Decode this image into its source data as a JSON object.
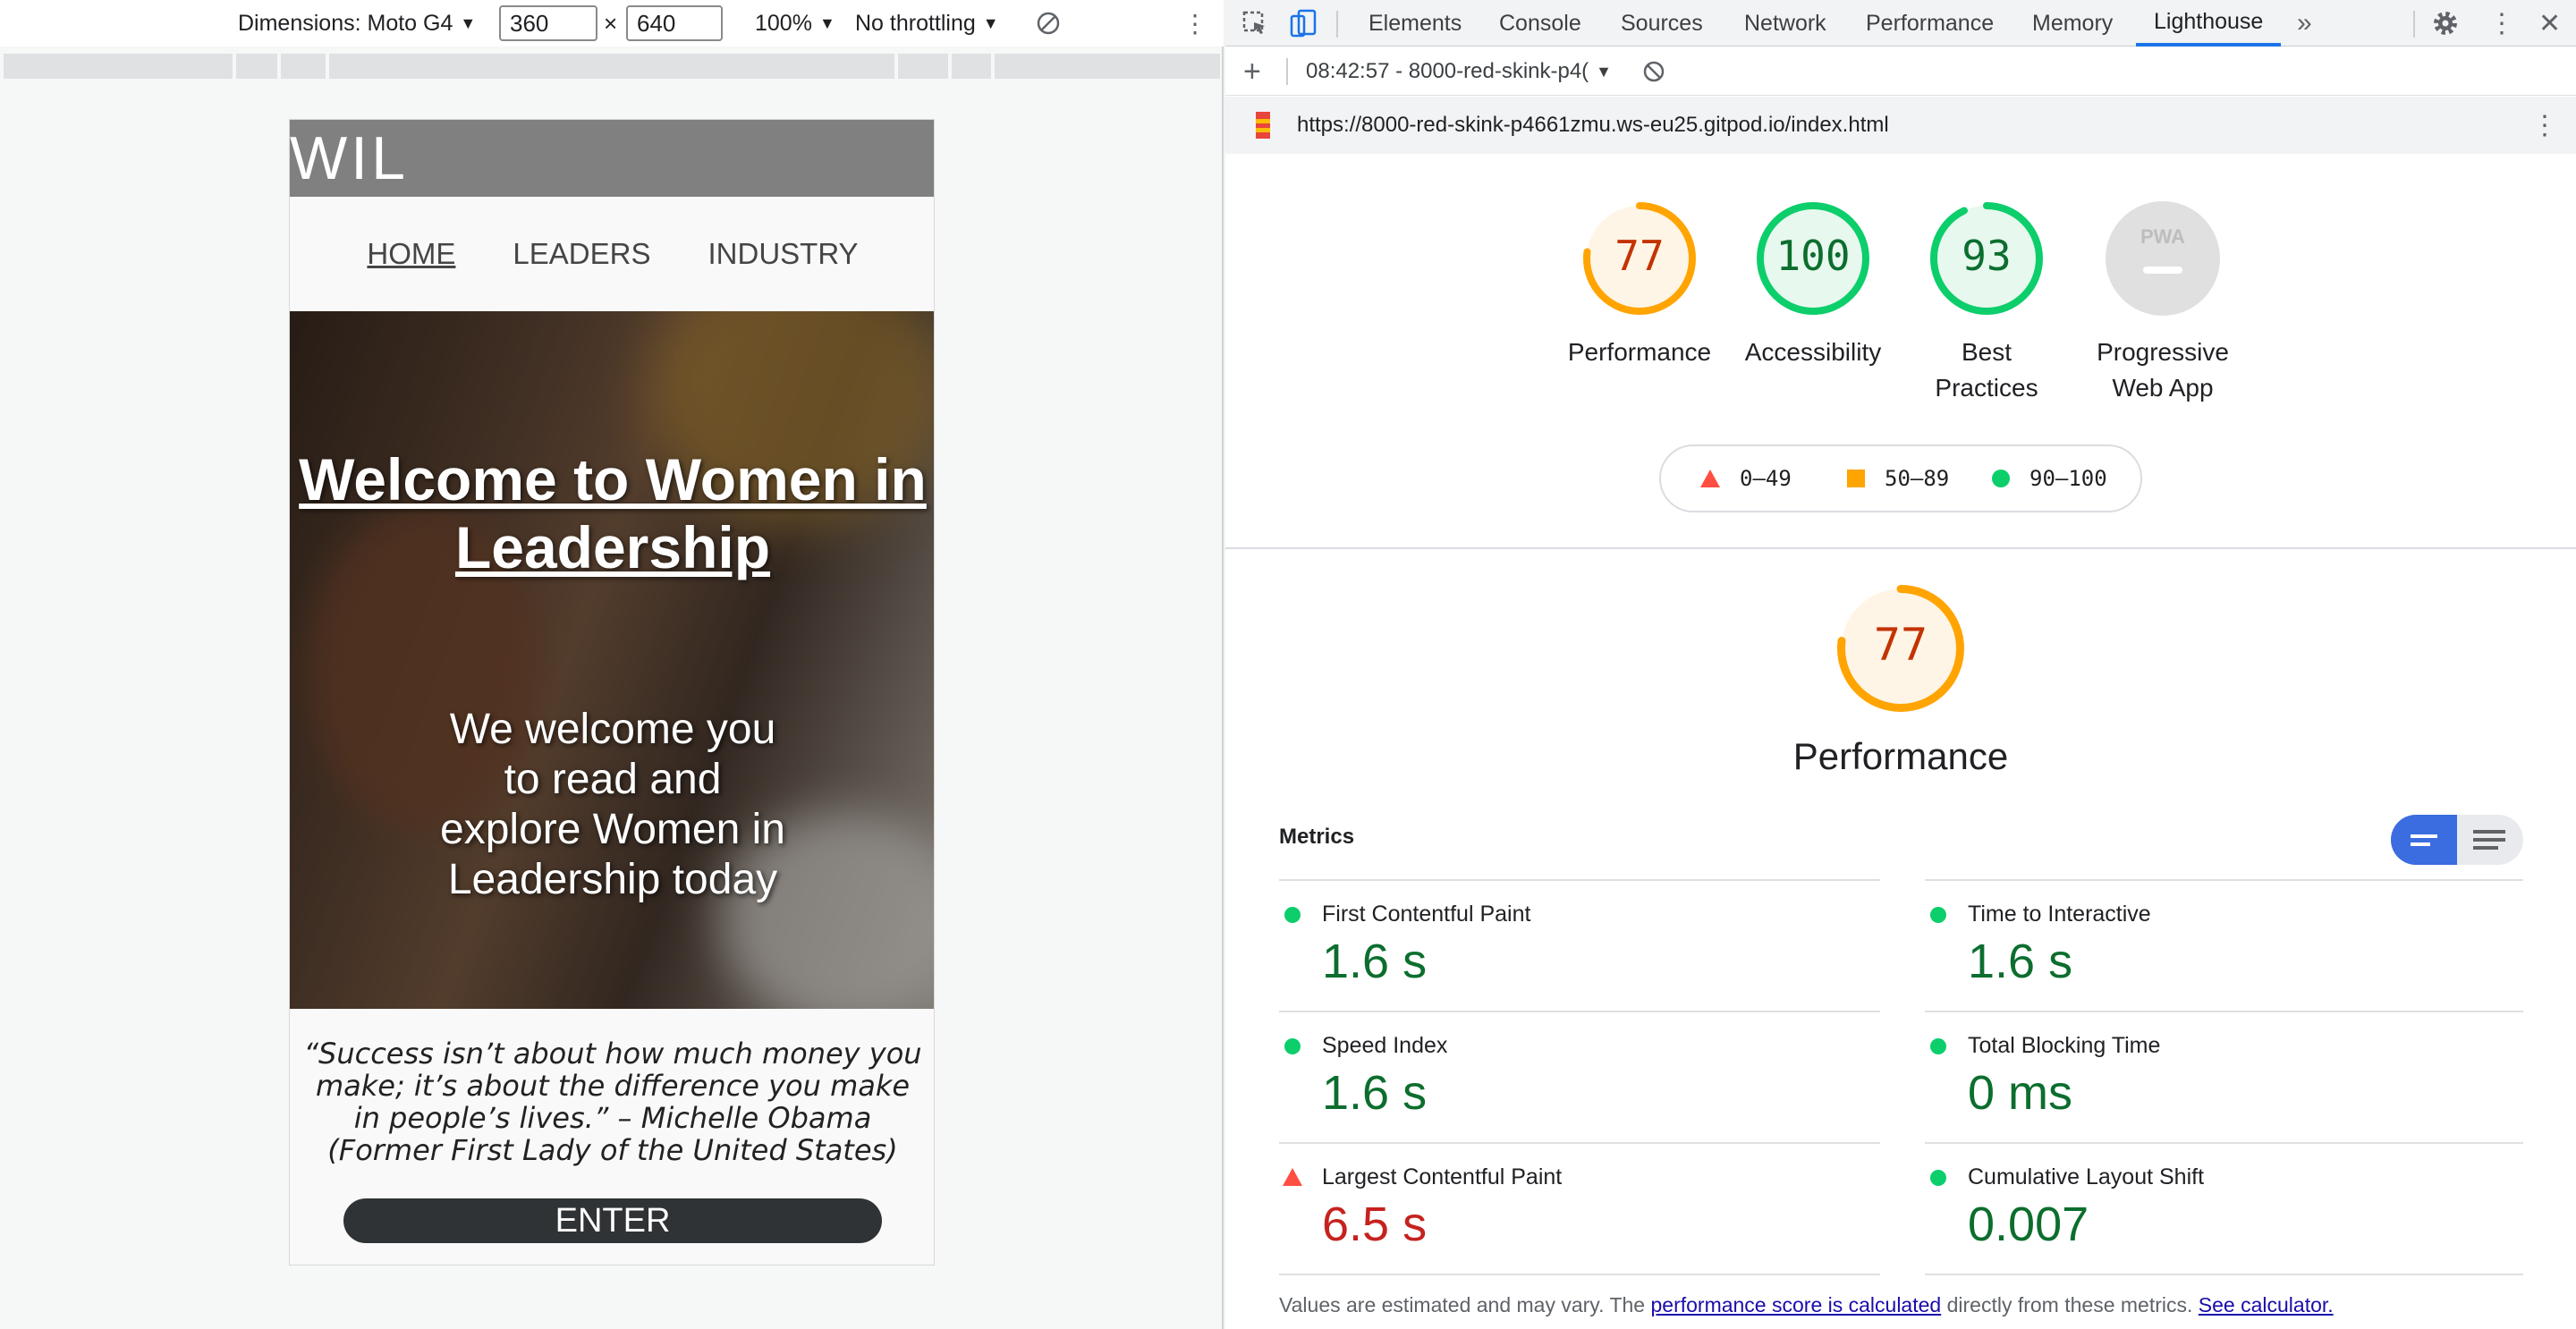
{
  "device_toolbar": {
    "dimensions_label": "Dimensions: Moto G4",
    "width_value": "360",
    "times": "×",
    "height_value": "640",
    "zoom": "100%",
    "throttling": "No throttling"
  },
  "site": {
    "logo": "WIL",
    "nav": [
      "HOME",
      "LEADERS",
      "INDUSTRY"
    ],
    "hero_title": "Welcome to Women in Leadership",
    "hero_subtitle": "We welcome you to read and explore Women in Leadership today",
    "quote": "“Success isn’t about how much money you make; it’s about the difference you make in people’s lives.” – Michelle Obama (Former First Lady of the United States)",
    "enter_label": "ENTER"
  },
  "devtools": {
    "tabs": [
      "Elements",
      "Console",
      "Sources",
      "Network",
      "Performance",
      "Memory",
      "Lighthouse"
    ],
    "active_tab": "Lighthouse",
    "more_tabs": "»",
    "report_selector": "08:42:57 - 8000-red-skink-p4(",
    "url": "https://8000-red-skink-p4661zmu.ws-eu25.gitpod.io/index.html"
  },
  "lighthouse": {
    "scores": [
      {
        "name": "Performance",
        "value": "77",
        "fraction": 0.77,
        "color": "#ffa400",
        "text_color": "#c33300"
      },
      {
        "name": "Accessibility",
        "value": "100",
        "fraction": 1.0,
        "color": "#0cce6b",
        "text_color": "#0c6e2e"
      },
      {
        "name": "Best Practices",
        "value": "93",
        "fraction": 0.93,
        "color": "#0cce6b",
        "text_color": "#0c6e2e"
      },
      {
        "name": "Progressive Web App",
        "value": "PWA",
        "fraction": 0,
        "color": "#9e9e9e",
        "text_color": "#9e9e9e"
      }
    ],
    "legend": [
      "0–49",
      "50–89",
      "90–100"
    ],
    "legend_colors": {
      "fail": "#ff4e42",
      "average": "#ffa400",
      "pass": "#0cce6b"
    },
    "section_title": "Performance",
    "section_score": "77",
    "metrics_title": "Metrics",
    "metrics": [
      {
        "name": "First Contentful Paint",
        "value": "1.6 s",
        "status": "pass"
      },
      {
        "name": "Time to Interactive",
        "value": "1.6 s",
        "status": "pass"
      },
      {
        "name": "Speed Index",
        "value": "1.6 s",
        "status": "pass"
      },
      {
        "name": "Total Blocking Time",
        "value": "0 ms",
        "status": "pass"
      },
      {
        "name": "Largest Contentful Paint",
        "value": "6.5 s",
        "status": "fail"
      },
      {
        "name": "Cumulative Layout Shift",
        "value": "0.007",
        "status": "pass"
      }
    ],
    "footnote_prefix": "Values are estimated and may vary. The ",
    "footnote_link": "performance score is calculated",
    "footnote_mid": " directly from these metrics. ",
    "footnote_link2": "See calculator."
  }
}
